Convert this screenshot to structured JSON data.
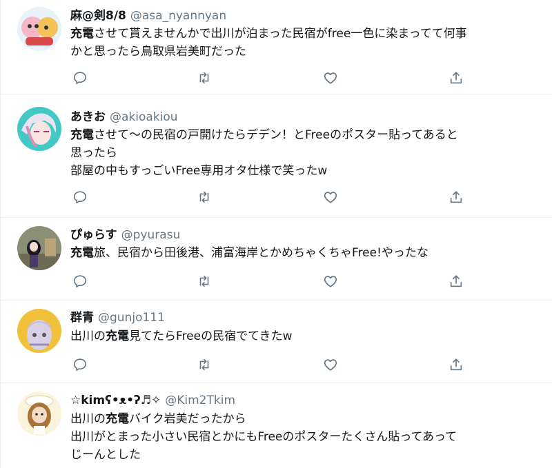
{
  "icon_color": "#657786",
  "tweets": [
    {
      "display_name": "麻@剣8/8",
      "handle": "@asa_nyannyan",
      "keyword": "充電",
      "line1_rest": "させて貰えませんかで出川が泊まった民宿がfree一色に染まってて何事",
      "line2": "かと思ったら鳥取県岩美町だった",
      "line3": ""
    },
    {
      "display_name": "あきお",
      "handle": "@akioakiou",
      "keyword": "充電",
      "line1_rest": "させて〜の民宿の戸開けたらデデン！とFreeのポスター貼ってあると",
      "line2": "思ったら",
      "line3": "部屋の中もすっごいFree専用オタ仕様で笑ったw"
    },
    {
      "display_name": "ぴゅらす",
      "handle": "@pyurasu",
      "keyword": "充電",
      "line1_rest": "旅、民宿から田後港、浦富海岸とかめちゃくちゃFree!やったな",
      "line2": "",
      "line3": ""
    },
    {
      "display_name": "群青",
      "handle": "@gunjo111",
      "line1_pre": "出川の",
      "keyword": "充電",
      "line1_rest": "見てたらFreeの民宿でてきたw",
      "line2": "",
      "line3": ""
    },
    {
      "display_name": "☆kimʕ•ᴥ•ʔ♬✧",
      "handle": "@Kim2Tkim",
      "line1_pre": "出川の",
      "keyword": "充電",
      "line1_rest": "バイク岩美だったから",
      "line2": "出川がとまった小さい民宿とかにもFreeのポスターたくさん貼ってあって",
      "line3": "じーんとした"
    }
  ]
}
